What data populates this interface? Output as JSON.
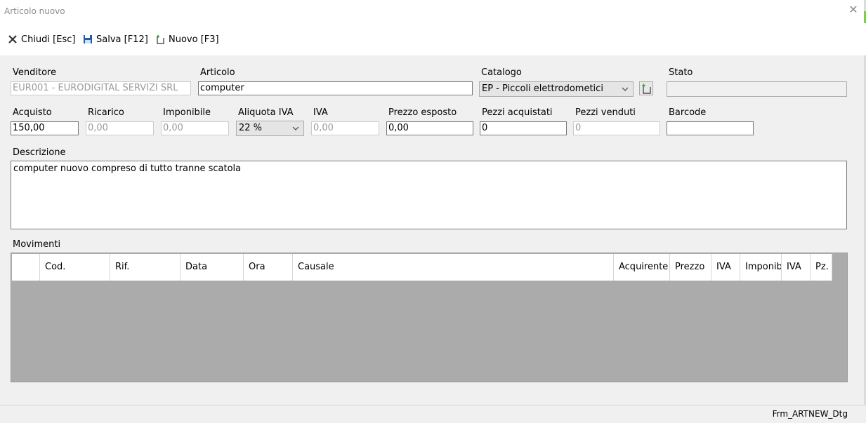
{
  "window": {
    "title": "Articolo nuovo"
  },
  "toolbar": {
    "close_label": "Chiudi [Esc]",
    "save_label": "Salva [F12]",
    "new_label": "Nuovo [F3]"
  },
  "form": {
    "venditore": {
      "label": "Venditore",
      "value": "EUR001 - EURODIGITAL SERVIZI SRL"
    },
    "articolo": {
      "label": "Articolo",
      "value": "computer"
    },
    "catalogo": {
      "label": "Catalogo",
      "value": "EP - Piccoli elettrodometici"
    },
    "stato": {
      "label": "Stato",
      "value": ""
    },
    "acquisto": {
      "label": "Acquisto",
      "value": "150,00"
    },
    "ricarico": {
      "label": "Ricarico",
      "value": "0,00"
    },
    "imponibile": {
      "label": "Imponibile",
      "value": "0,00"
    },
    "aliquota_iva": {
      "label": "Aliquota IVA",
      "value": "22 %"
    },
    "iva": {
      "label": "IVA",
      "value": "0,00"
    },
    "prezzo_esposto": {
      "label": "Prezzo esposto",
      "value": "0,00"
    },
    "pezzi_acquistati": {
      "label": "Pezzi acquistati",
      "value": "0"
    },
    "pezzi_venduti": {
      "label": "Pezzi venduti",
      "value": "0"
    },
    "barcode": {
      "label": "Barcode",
      "value": ""
    },
    "descrizione": {
      "label": "Descrizione",
      "value": "computer nuovo compreso di tutto tranne scatola"
    }
  },
  "movimenti": {
    "label": "Movimenti",
    "columns": [
      "",
      "Cod.",
      "Rif.",
      "Data",
      "Ora",
      "Causale",
      "Acquirente",
      "Prezzo",
      "IVA",
      "Imponib.",
      "IVA",
      "Pz."
    ],
    "rows": []
  },
  "statusbar": {
    "form_name": "Frm_ARTNEW_Dtg"
  },
  "icons": {
    "close": "close-x-icon",
    "save": "floppy-disk-icon",
    "new": "new-document-icon",
    "add_catalog": "add-document-icon",
    "window_close": "window-close-icon",
    "dropdown": "chevron-down-icon"
  },
  "colors": {
    "save_icon": "#1f5fa8",
    "accent_green": "#3aa33a"
  }
}
